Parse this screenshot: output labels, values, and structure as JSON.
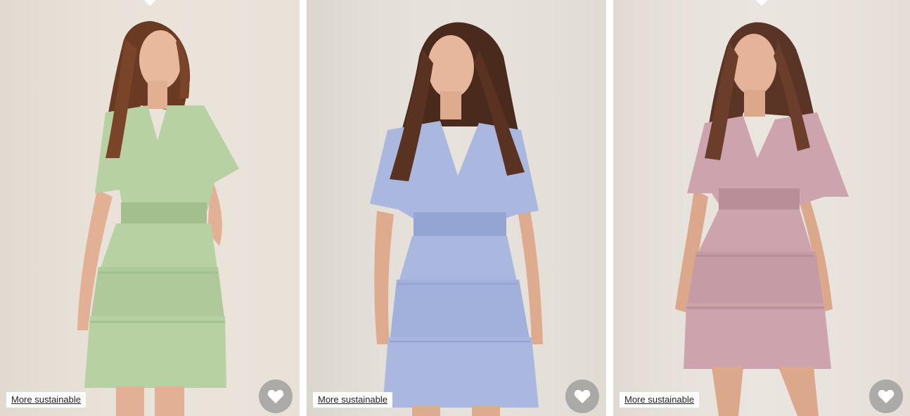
{
  "products": [
    {
      "name": "green-dress",
      "badge_label": "More sustainable",
      "favorite_icon": "heart-icon",
      "colors": {
        "background": "#e8e2d9",
        "dress": "#b8d1a3",
        "dress_shade": "#a3bf8d",
        "hair": "#6b3a22",
        "skin": "#e8b99d"
      }
    },
    {
      "name": "blue-dress",
      "badge_label": "More sustainable",
      "favorite_icon": "heart-icon",
      "colors": {
        "background": "#e5e1da",
        "dress": "#aab8e0",
        "dress_shade": "#95a5d3",
        "hair": "#4a2a1c",
        "skin": "#e6b79c"
      }
    },
    {
      "name": "rose-dress",
      "badge_label": "More sustainable",
      "favorite_icon": "heart-icon",
      "colors": {
        "background": "#e8e3dc",
        "dress": "#cda4ad",
        "dress_shade": "#b98e98",
        "hair": "#5a3424",
        "skin": "#e4b399"
      }
    }
  ]
}
